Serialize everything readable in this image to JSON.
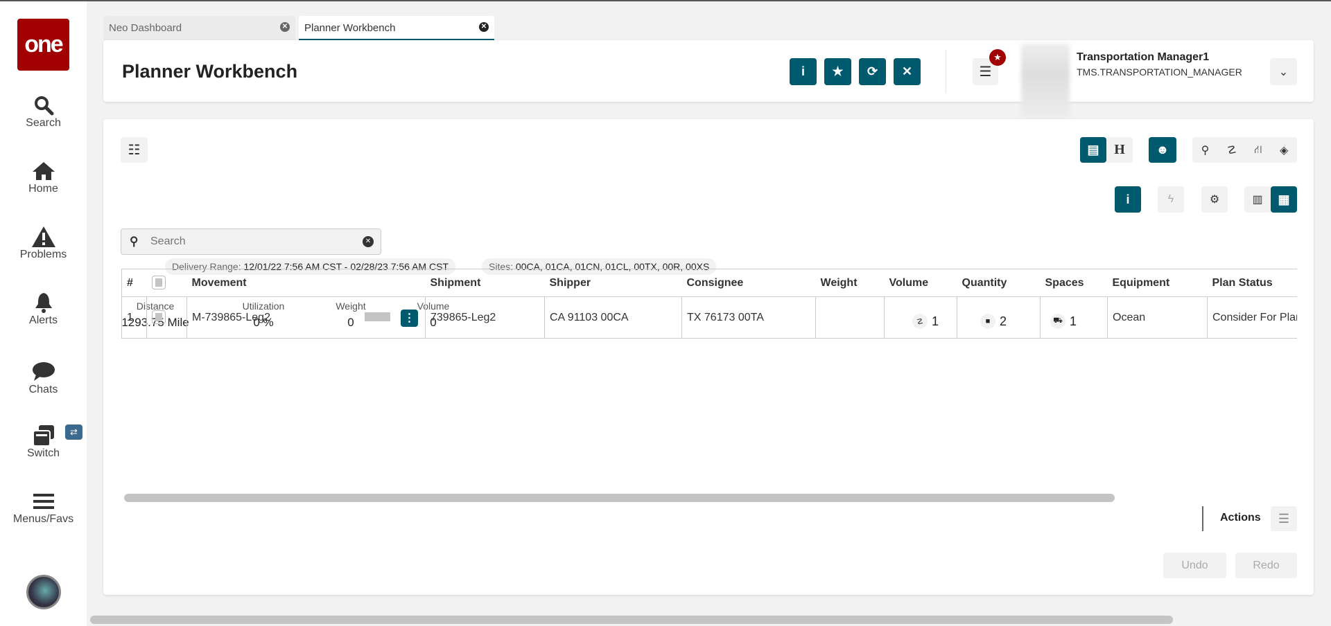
{
  "sidebar": {
    "logo": "one",
    "items": [
      {
        "label": "Search"
      },
      {
        "label": "Home"
      },
      {
        "label": "Problems"
      },
      {
        "label": "Alerts"
      },
      {
        "label": "Chats"
      },
      {
        "label": "Switch"
      },
      {
        "label": "Menus/Favs"
      }
    ]
  },
  "tabs": [
    {
      "label": "Neo Dashboard"
    },
    {
      "label": "Planner Workbench"
    }
  ],
  "header": {
    "title": "Planner Workbench",
    "user_name": "Transportation Manager1",
    "user_role": "TMS.TRANSPORTATION_MANAGER"
  },
  "filters": {
    "delivery_label": "Delivery Range:",
    "delivery_value": "12/01/22 7:56 AM CST - 02/28/23 7:56 AM CST",
    "sites_label": "Sites:",
    "sites_value": "00CA, 01CA, 01CN, 01CL, 00TX, 00R, 00XS"
  },
  "stats": [
    {
      "label": "Distance",
      "value": "1293.75 Mile"
    },
    {
      "label": "Utilization",
      "value": "0 %"
    },
    {
      "label": "Weight",
      "value": "0"
    },
    {
      "label": "Volume",
      "value": "0"
    }
  ],
  "counts": [
    {
      "icon": "route-icon",
      "value": "1"
    },
    {
      "icon": "stop-icon",
      "value": "2"
    },
    {
      "icon": "truck-icon",
      "value": "1"
    }
  ],
  "search": {
    "placeholder": "Search",
    "value": ""
  },
  "table": {
    "columns": [
      "#",
      "",
      "Movement",
      "Shipment",
      "Shipper",
      "Consignee",
      "Weight",
      "Volume",
      "Quantity",
      "Spaces",
      "Equipment",
      "Plan Status"
    ],
    "rows": [
      {
        "num": "1",
        "movement": "M-739865-Leg2",
        "shipment": "739865-Leg2",
        "shipper": "CA 91103 00CA",
        "consignee": "TX 76173 00TA",
        "weight": "",
        "volume": "",
        "quantity": "",
        "spaces": "",
        "equipment": "Ocean",
        "plan_status": "Consider For Planning"
      }
    ]
  },
  "footer": {
    "actions": "Actions",
    "undo": "Undo",
    "redo": "Redo"
  },
  "colors": {
    "accent": "#005a6e",
    "logo": "#a00000"
  }
}
